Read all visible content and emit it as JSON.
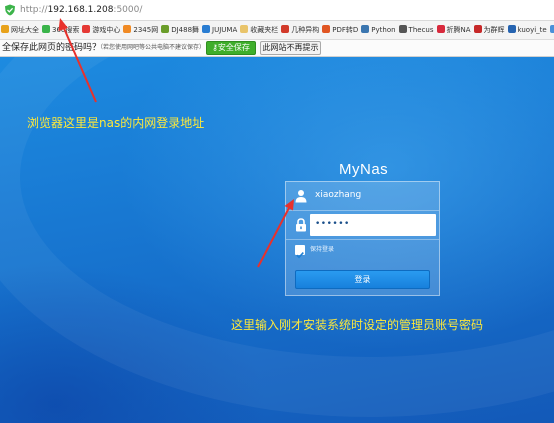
{
  "browser": {
    "url": {
      "protocol": "http://",
      "host": "192.168.1.208",
      "port_path": ":5000/"
    },
    "bookmarks": [
      {
        "label": "网址大全",
        "color": "#e8a21b"
      },
      {
        "label": "360搜索",
        "color": "#3ab44a"
      },
      {
        "label": "游戏中心",
        "color": "#e53935"
      },
      {
        "label": "2345网",
        "color": "#f08a24"
      },
      {
        "label": "DJ488舞",
        "color": "#6a9d2a"
      },
      {
        "label": "JUJUMA",
        "color": "#2a7dd2"
      },
      {
        "label": "收藏夹栏",
        "color": "#e9c46a"
      },
      {
        "label": "几种异构",
        "color": "#d23a2a"
      },
      {
        "label": "PDF转D",
        "color": "#e05522"
      },
      {
        "label": "Python",
        "color": "#3b76b0"
      },
      {
        "label": "Thecus",
        "color": "#555555"
      },
      {
        "label": "折腾NA",
        "color": "#d8293c"
      },
      {
        "label": "为群辉",
        "color": "#c62828"
      },
      {
        "label": "kuoyi_te",
        "color": "#2563b0"
      },
      {
        "label": "教你怎",
        "color": "#4a90d9"
      }
    ],
    "save_prompt": {
      "question": "全保存此网页的密码吗？",
      "hint": "（若您使用网吧等公共电脑不建议保存）",
      "save_label": "安全保存",
      "never_label": "此网站不再提示"
    }
  },
  "annotations": {
    "address_note": "浏览器这里是nas的内网登录地址",
    "password_note": "这里输入刚才安装系统时设定的管理员账号密码"
  },
  "login": {
    "brand": "MyNas",
    "username": "xiaozhang",
    "password_mask": "••••••",
    "remember_label": "保持登录",
    "remember_checked": true,
    "submit_label": "登录"
  },
  "colors": {
    "annotation_text": "#ffe93a",
    "arrow": "#e8312c",
    "save_button": "#3fae2a",
    "login_button": "#1f8ee8"
  }
}
